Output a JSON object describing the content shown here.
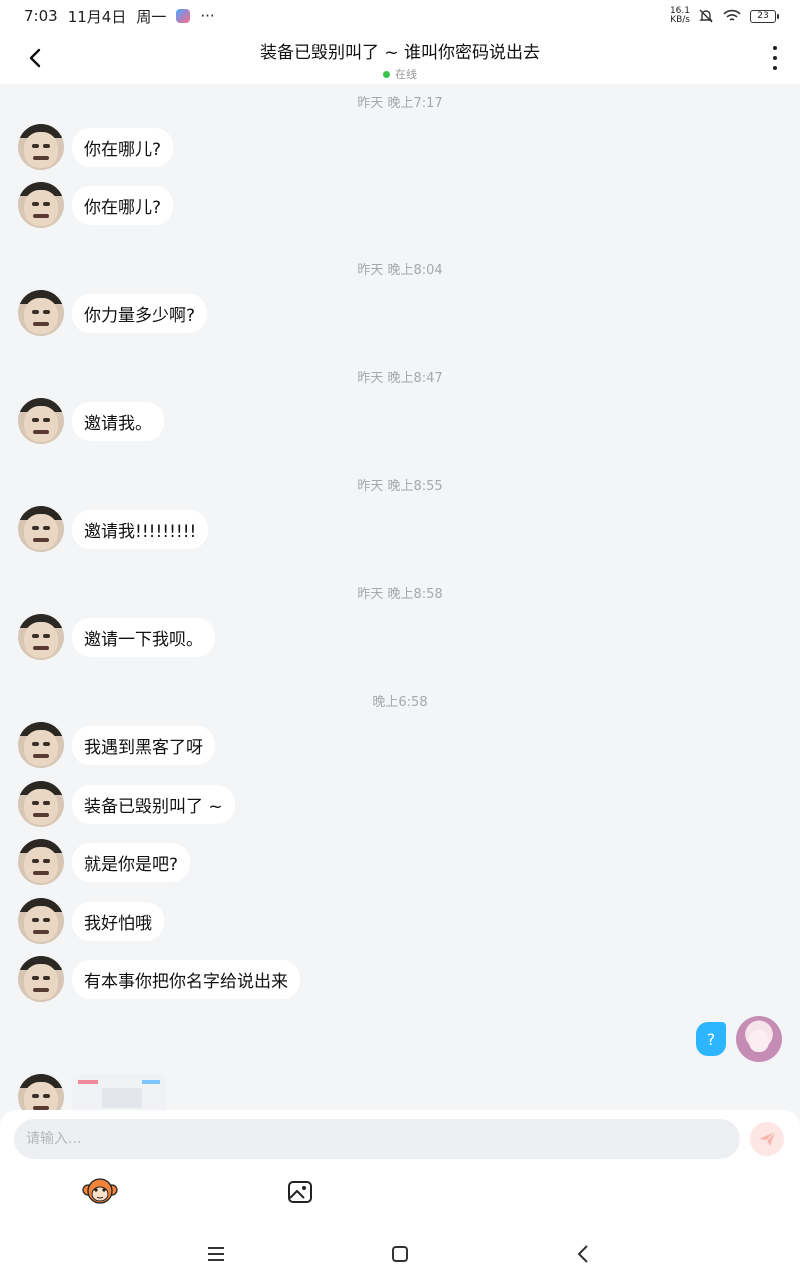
{
  "status": {
    "time": "7:03",
    "date": "11月4日",
    "weekday": "周一",
    "more": "···",
    "net_speed_top": "16.1",
    "net_speed_unit": "KB/s",
    "battery": "23"
  },
  "header": {
    "title": "装备已毁别叫了 ~ 谁叫你密码说出去",
    "status": "在线"
  },
  "messages": [
    {
      "time": "昨天 晚上7:17"
    },
    {
      "text": "你在哪儿?"
    },
    {
      "text": "你在哪儿?"
    },
    {
      "time": "昨天 晚上8:04"
    },
    {
      "text": "你力量多少啊?"
    },
    {
      "time": "昨天 晚上8:47"
    },
    {
      "text": "邀请我。"
    },
    {
      "time": "昨天 晚上8:55"
    },
    {
      "text": "邀请我!!!!!!!!!"
    },
    {
      "time": "昨天 晚上8:58"
    },
    {
      "text": "邀请一下我呗。"
    },
    {
      "time": "晚上6:58"
    },
    {
      "text": "我遇到黑客了呀"
    },
    {
      "text": "装备已毁别叫了 ~"
    },
    {
      "text": "就是你是吧?"
    },
    {
      "text": "我好怕哦"
    },
    {
      "text": "有本事你把你名字给说出来"
    },
    {
      "text": "?"
    }
  ],
  "input": {
    "placeholder": "请输入..."
  },
  "icons": {
    "back": "chevron-left-icon",
    "more": "more-vertical-icon",
    "send": "send-icon",
    "monkey": "monkey-sticker-icon",
    "image": "image-icon",
    "online_color": "#3bc24a",
    "accent": "#2db6ff"
  }
}
